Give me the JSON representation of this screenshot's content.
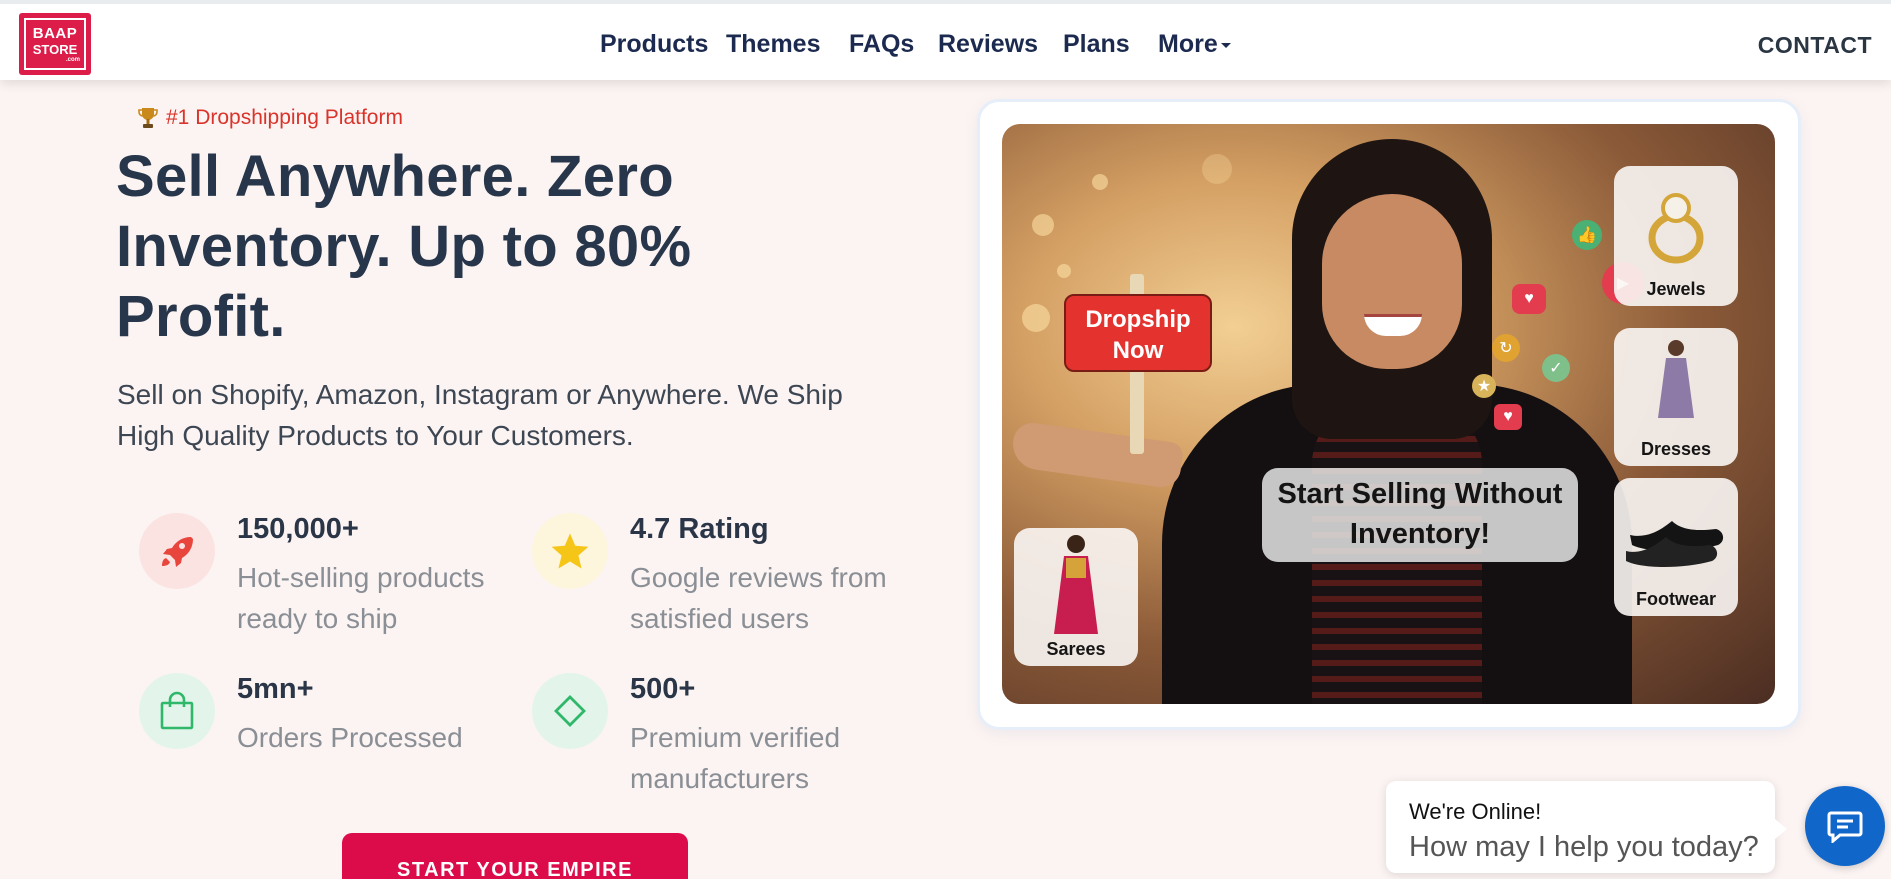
{
  "header": {
    "logo": {
      "line1": "BAAP",
      "line2": "STORE",
      "line3": ".com"
    },
    "nav": [
      "Products",
      "Themes",
      "FAQs",
      "Reviews",
      "Plans",
      "More"
    ],
    "contact": "CONTACT"
  },
  "hero": {
    "tag": "#1 Dropshipping Platform",
    "headline": "Sell Anywhere. Zero Inventory. Up to 80% Profit.",
    "subtext": "Sell on Shopify, Amazon, Instagram or Anywhere. We Ship High Quality Products to Your Customers.",
    "stats": [
      {
        "title": "150,000+",
        "desc": "Hot-selling products ready to ship",
        "icon": "rocket-icon",
        "color": "#e8453c"
      },
      {
        "title": "4.7 Rating",
        "desc": "Google reviews from satisfied users",
        "icon": "star-icon",
        "color": "#f5c518"
      },
      {
        "title": "5mn+",
        "desc": "Orders Processed",
        "icon": "shopping-bag-icon",
        "color": "#2fb86a"
      },
      {
        "title": "500+",
        "desc": "Premium verified manufacturers",
        "icon": "diamond-icon",
        "color": "#2fb86a"
      }
    ],
    "cta": "START YOUR EMPIRE"
  },
  "image": {
    "sign": "Dropship Now",
    "banner": "Start Selling Without Inventory!",
    "tiles": [
      "Jewels",
      "Dresses",
      "Footwear",
      "Sarees"
    ]
  },
  "chat": {
    "online": "We're Online!",
    "help": "How may I help you today?"
  },
  "colors": {
    "brand": "#dc1d4a",
    "cta": "#dc0c4b",
    "chat": "#1167c9",
    "nav": "#1b2a4e"
  }
}
